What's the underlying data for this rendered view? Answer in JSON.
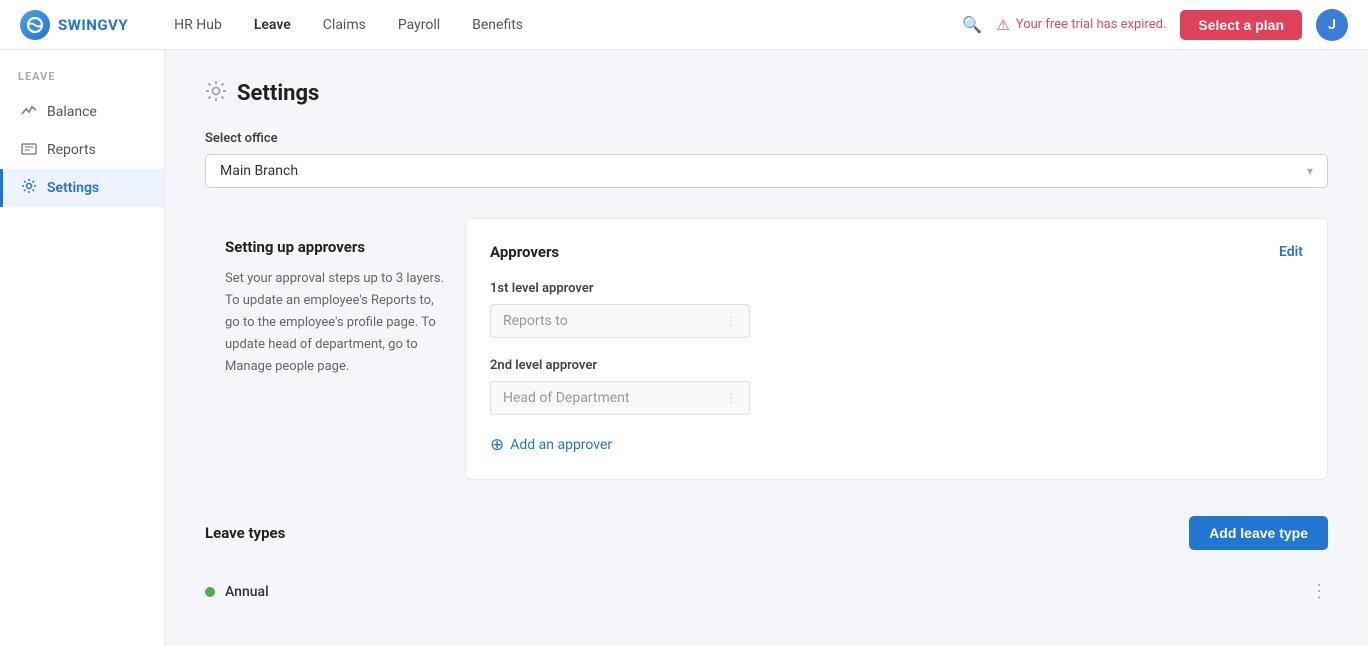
{
  "app": {
    "logo_text": "SWINGVY"
  },
  "topnav": {
    "items": [
      {
        "label": "HR Hub",
        "active": false
      },
      {
        "label": "Leave",
        "active": true
      },
      {
        "label": "Claims",
        "active": false
      },
      {
        "label": "Payroll",
        "active": false
      },
      {
        "label": "Benefits",
        "active": false
      }
    ],
    "trial_text": "Your free trial has expired.",
    "select_plan_label": "Select a plan",
    "avatar_initial": "J"
  },
  "sidebar": {
    "section_label": "LEAVE",
    "items": [
      {
        "label": "Balance",
        "icon": "〜",
        "active": false
      },
      {
        "label": "Reports",
        "icon": "▦",
        "active": false
      },
      {
        "label": "Settings",
        "icon": "⚙",
        "active": true
      }
    ]
  },
  "page": {
    "icon": "⚙",
    "title": "Settings"
  },
  "office_select": {
    "label": "Select office",
    "value": "Main Branch"
  },
  "approvers_card": {
    "left": {
      "title": "Setting up approvers",
      "description": "Set your approval steps up to 3 layers. To update an employee's Reports to, go to the employee's profile page. To update head of department, go to Manage people page."
    },
    "right": {
      "title": "Approvers",
      "edit_label": "Edit",
      "level1": {
        "label": "1st level approver",
        "placeholder": "Reports to"
      },
      "level2": {
        "label": "2nd level approver",
        "placeholder": "Head of Department"
      },
      "add_approver_label": "Add an approver"
    }
  },
  "leave_types": {
    "title": "Leave types",
    "add_button_label": "Add leave type",
    "items": [
      {
        "name": "Annual",
        "color": "#4caf50"
      }
    ]
  }
}
